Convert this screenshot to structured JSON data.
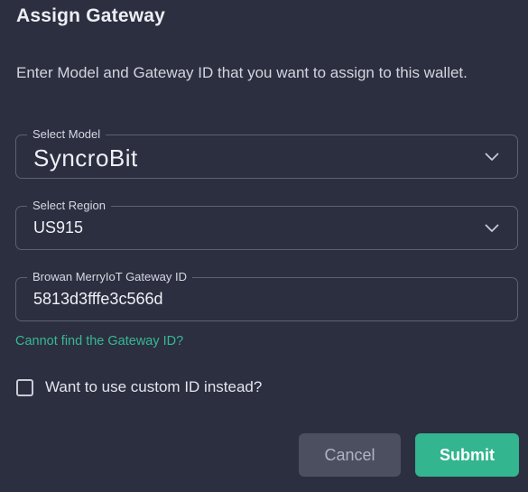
{
  "dialog": {
    "title": "Assign Gateway",
    "description": "Enter Model and Gateway ID that you want to assign to this wallet."
  },
  "form": {
    "model": {
      "label": "Select Model",
      "value": "SyncroBit"
    },
    "region": {
      "label": "Select Region",
      "value": "US915"
    },
    "gateway_id": {
      "label": "Browan MerryIoT Gateway ID",
      "value": "5813d3fffe3c566d"
    },
    "help_link": "Cannot find the Gateway ID?",
    "custom_id_checkbox": {
      "label": "Want to use custom ID instead?",
      "checked": false
    }
  },
  "actions": {
    "cancel_label": "Cancel",
    "submit_label": "Submit"
  },
  "colors": {
    "background": "#2c2f40",
    "accent": "#33b58f",
    "link": "#36b894",
    "cancel_button": "#4b4f60"
  },
  "icons": {
    "select_arrow": "chevron-down-icon"
  }
}
